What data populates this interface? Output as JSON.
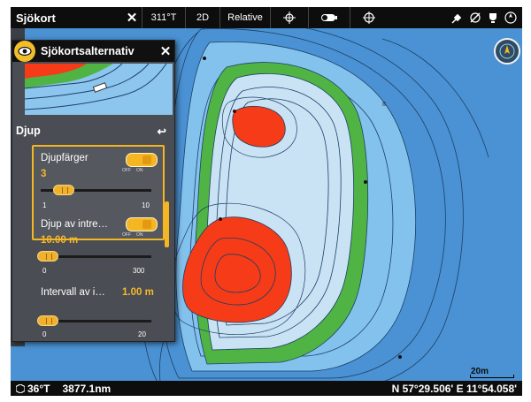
{
  "topbar": {
    "title": "Sjökort",
    "close": "✕",
    "heading": "311°T",
    "view": "2D",
    "mode": "Relative"
  },
  "bottombar": {
    "heading": "36°T",
    "distance": "3877.1nm",
    "position": "N 57°29.506' E 11°54.058'"
  },
  "panel": {
    "title": "Sjökortsalternativ",
    "close": "✕",
    "section": "Djup",
    "back": "↩",
    "items": [
      {
        "label": "Djupfärger",
        "value": "3",
        "toggle_on": true,
        "off": "OFF",
        "on": "ON",
        "min": "1",
        "max": "10",
        "slider_value": 3
      },
      {
        "label": "Djup av intre…",
        "value": "10.00 m",
        "toggle_on": true,
        "off": "OFF",
        "on": "ON",
        "min": "0",
        "max": "300",
        "slider_value": 10
      },
      {
        "label": "Intervall av i…",
        "value": "1.00 m",
        "min": "0",
        "max": "20",
        "slider_value": 1
      }
    ]
  },
  "map": {
    "scale": "20m",
    "colors": {
      "deep": "#4a92d3",
      "mid": "#85c3ef",
      "shallow": "#c7e2f4",
      "green": "#4fb444",
      "red": "#f53b17"
    }
  }
}
